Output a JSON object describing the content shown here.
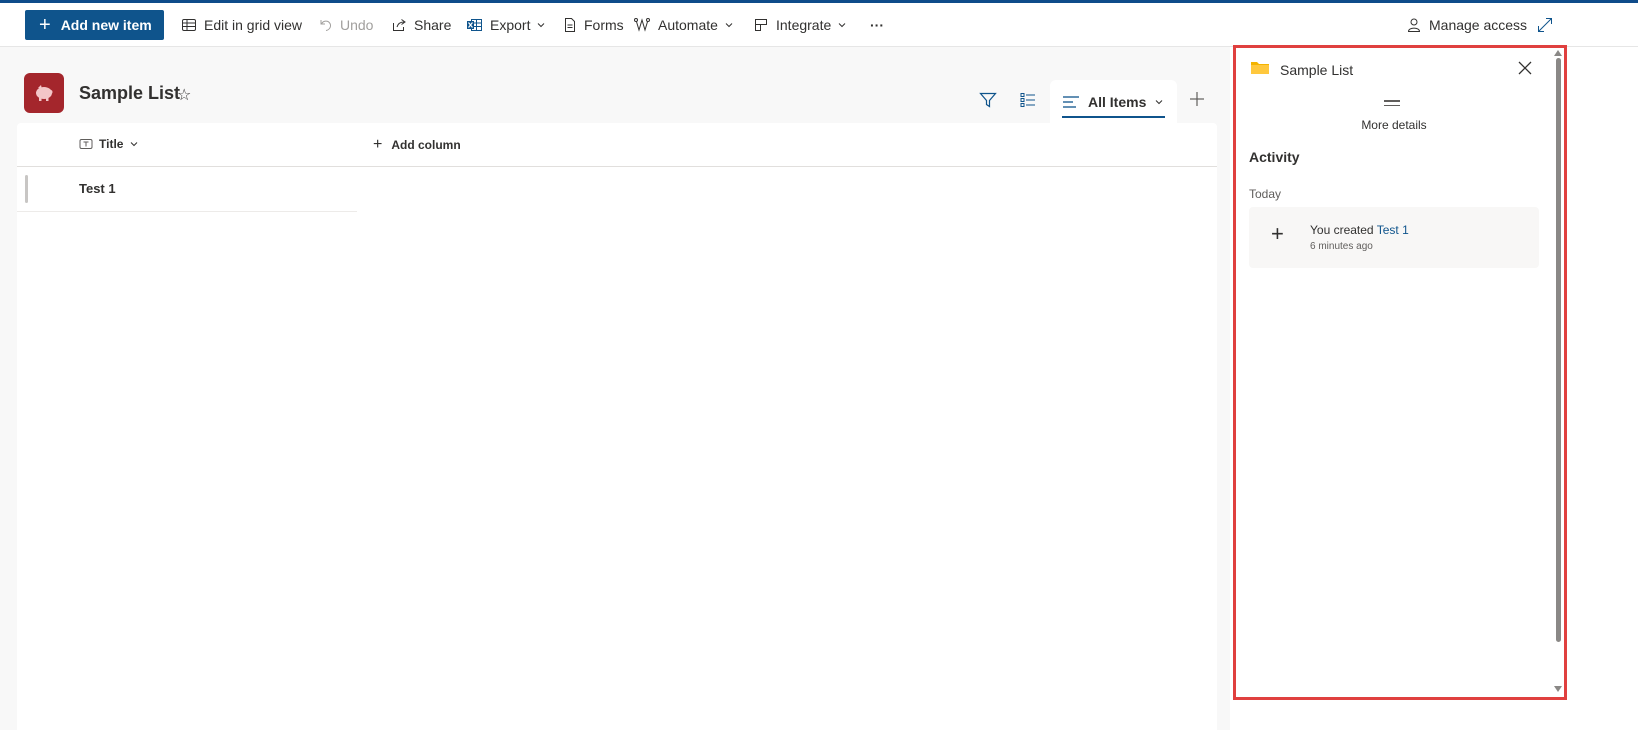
{
  "commandbar": {
    "add_new_item": "Add new item",
    "edit_grid": "Edit in grid view",
    "undo": "Undo",
    "share": "Share",
    "export": "Export",
    "forms": "Forms",
    "automate": "Automate",
    "integrate": "Integrate",
    "more": "···",
    "manage_access": "Manage access"
  },
  "list": {
    "title": "Sample List",
    "favorite_glyph": "☆"
  },
  "view": {
    "current": "All Items"
  },
  "grid": {
    "columns": [
      "Title"
    ],
    "add_column": "Add column",
    "rows": [
      {
        "title": "Test 1"
      }
    ]
  },
  "panel": {
    "title": "Sample List",
    "more_details": "More details",
    "activity_heading": "Activity",
    "group_today": "Today",
    "activity": [
      {
        "prefix": "You created ",
        "link": "Test 1",
        "time": "6 minutes ago"
      }
    ]
  },
  "colors": {
    "brand": "#0f548c",
    "list_icon": "#a4262c",
    "highlight_border": "#e0403f",
    "folder": "#f4b400"
  },
  "icons": [
    "add-icon",
    "grid-icon",
    "undo-icon",
    "share-icon",
    "excel-icon",
    "forms-icon",
    "automate-icon",
    "integrate-icon",
    "more-icon",
    "person-icon",
    "expand-icon",
    "filter-icon",
    "list-settings-icon",
    "view-lines-icon",
    "add-view-icon",
    "title-field-icon",
    "chevron-down-icon",
    "folder-icon",
    "close-icon"
  ]
}
